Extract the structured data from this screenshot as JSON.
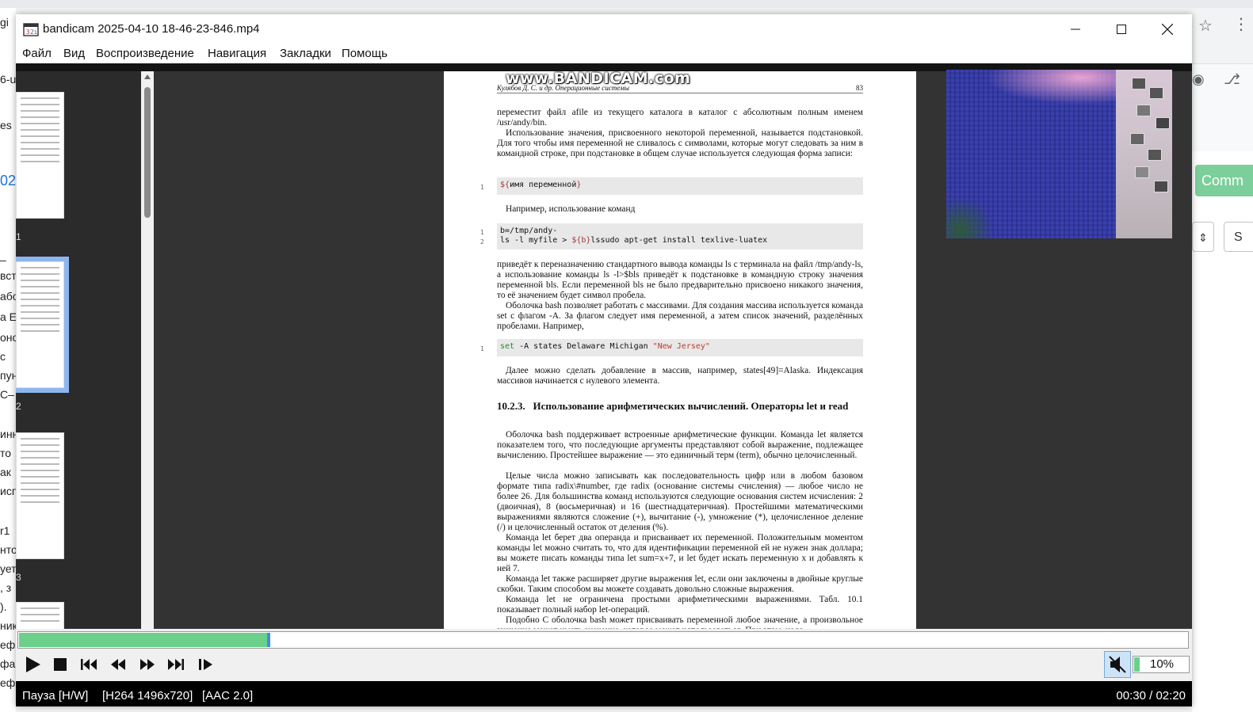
{
  "window": {
    "title": "bandicam 2025-04-10 18-46-23-846.mp4"
  },
  "menu": [
    "Файл",
    "Вид",
    "Воспроизведение",
    "Навигация",
    "Закладки",
    "Помощь"
  ],
  "background": {
    "left_fragments": [
      "gi",
      "6-u",
      "es",
      "02",
      "–",
      "вст",
      "або",
      "а Е",
      "оно",
      "с",
      "пун",
      "С–",
      "инн",
      "то",
      "ак",
      "исп",
      "r1",
      "нто",
      "ует",
      ", з",
      ").",
      "ник",
      "ефи",
      "фа",
      "ефи"
    ],
    "right_button": "Comm",
    "right_box": "S"
  },
  "sidebar": {
    "page_numbers": [
      "1",
      "2",
      "3"
    ]
  },
  "document": {
    "watermark": "www.BANDICAM.com",
    "header_left": "Кулябов Д. С. и др. Операционные системы",
    "header_page": "83",
    "p1": "переместит файл afile из текущего каталога в каталог с абсолютным полным именем /usr/andy/bin.",
    "p2": "Использование значения, присвоенного некоторой переменной, называется подстановкой. Для того чтобы имя переменной не сливалось с символами, которые могут следовать за ним в командной строке, при подстановке в общем случае используется следующая форма записи:",
    "code1_open": "${",
    "code1_body": "имя переменной",
    "code1_close": "}",
    "p3": "Например, использование команд",
    "code2_line1": "b=/tmp/andy-",
    "code2_line2_a": "ls -l myfile > ",
    "code2_line2_b": "${b}",
    "code2_line2_c": "lssudo apt-get install texlive-luatex",
    "p4": "приведёт к переназначению стандартного вывода команды ls с терминала на файл /tmp/andy-ls, а использование команды ls -l>$bls приведёт к подстановке в командную строку значения переменной bls. Если переменной bls не было предварительно присвоено никакого значения, то её значением будет символ пробела.",
    "p5": "Оболочка bash позволяет работать с массивами. Для создания массива используется команда set с флагом -A. За флагом следует имя переменной, а затем список значений, разделённых пробелами. Например,",
    "code3_kw": "set",
    "code3_mid": " -A states Delaware Michigan ",
    "code3_str": "\"New Jersey\"",
    "p6": "Далее можно сделать добавление в массив, например, states[49]=Alaska. Индексация массивов начинается с нулевого элемента.",
    "h_num": "10.2.3.",
    "h_title": "Использование арифметических вычислений. Операторы let и read",
    "p7": "Оболочка bash поддерживает встроенные арифметические функции. Команда let является показателем того, что последующие аргументы представляют собой выражение, подлежащее вычислению. Простейшее выражение — это единичный терм (term), обычно целочисленный.",
    "p8": "Целые числа можно записывать как последовательность цифр или в любом базовом формате типа radix\\#number, где radix (основание системы счисления) — любое число не более 26. Для большинства команд используются следующие основания систем исчисления: 2 (двоичная), 8 (восьмеричная) и 16 (шестнадцатеричная). Простейшими математическими выражениями являются сложение (+), вычитание (-), умножение (*), целочисленное деление (/) и целочисленный остаток от деления (%).",
    "p9": "Команда let берет два операнда и присваивает их переменной. Положительным моментом команды let можно считать то, что для идентификации переменной ей не нужен знак доллара; вы можете писать команды типа let sum=x+7, и let будет искать переменную x и добавлять к ней 7.",
    "p10": "Команда let также расширяет другие выражения let, если они заключены в двойные круглые скобки. Таким способом вы можете создавать довольно сложные выражения.",
    "p11": "Команда let не ограничена простыми арифметическими выражениями. Табл. 10.1 показывает полный набор let-операций.",
    "p12": "Подобно С оболочка bash может присваивать переменной любое значение, а произвольное значение может иметь значение, которое может использоваться. При этом, надо"
  },
  "playback": {
    "progress": 0.213,
    "volume_label": "10%",
    "volume_level": 0.1,
    "muted": true
  },
  "status": {
    "state": "Пауза [H/W]",
    "video": "[H264 1496x720]",
    "audio": "[AAC 2.0]",
    "time": "00:30 / 02:20"
  },
  "colors": {
    "progress": "#6bd18a",
    "seek_marker": "#3d8fe0",
    "status_bg": "#000000"
  }
}
